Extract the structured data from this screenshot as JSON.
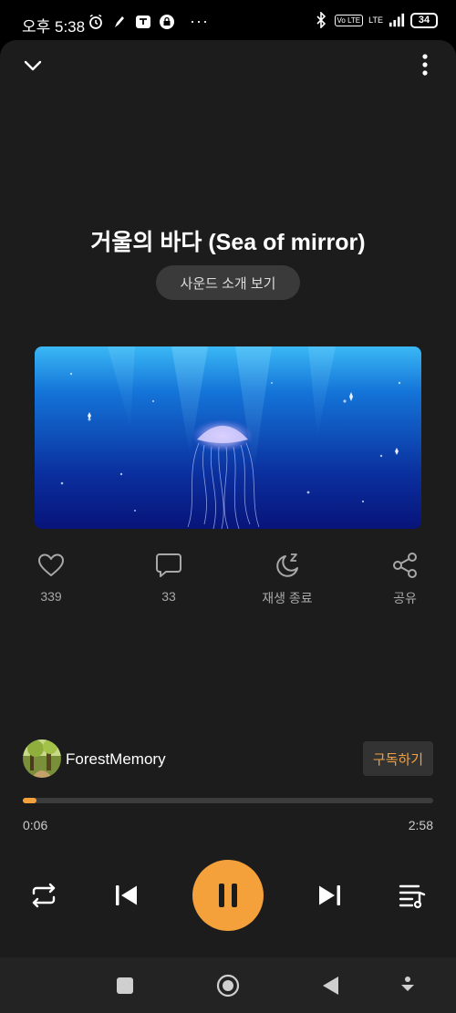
{
  "status_bar": {
    "time": "오후 5:38",
    "left_icons": [
      "alarm-icon",
      "pen-icon",
      "talk-icon",
      "lock-icon"
    ],
    "more_dots": "···",
    "lte_badge": "Vo LTE",
    "lte_text": "LTE",
    "battery": "34"
  },
  "header": {
    "collapse_icon": "chevron-down-icon",
    "menu_icon": "more-vertical-icon"
  },
  "track": {
    "title": "거울의 바다 (Sea of mirror)",
    "intro_button": "사운드 소개 보기"
  },
  "actions": [
    {
      "icon": "heart-icon",
      "label": "339"
    },
    {
      "icon": "comment-icon",
      "label": "33"
    },
    {
      "icon": "sleep-timer-icon",
      "label": "재생 종료"
    },
    {
      "icon": "share-icon",
      "label": "공유"
    }
  ],
  "artist": {
    "name": "ForestMemory",
    "subscribe": "구독하기"
  },
  "progress": {
    "current": "0:06",
    "total": "2:58",
    "fraction": 0.034
  },
  "controls": [
    "repeat-icon",
    "previous-icon",
    "pause-icon",
    "next-icon",
    "playlist-icon"
  ],
  "colors": {
    "accent": "#f4a13c",
    "background": "#1c1c1c"
  }
}
